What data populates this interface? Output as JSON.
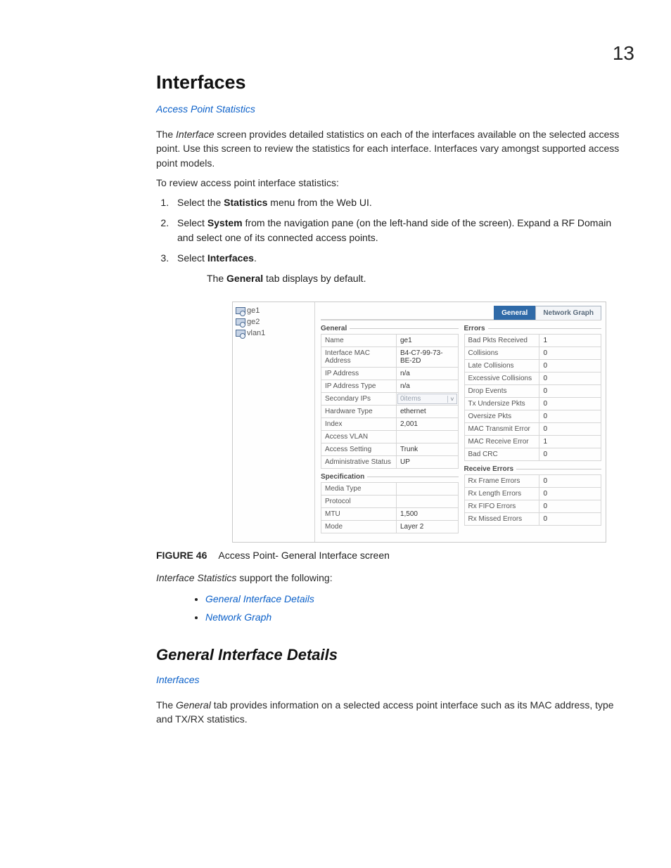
{
  "pageNumber": "13",
  "h1": "Interfaces",
  "link_aps": "Access Point Statistics",
  "p1_a": "The ",
  "p1_b": "Interface",
  "p1_c": " screen provides detailed statistics on each of the interfaces available on the selected access point. Use this screen to review the statistics for each interface. Interfaces vary amongst supported access point models.",
  "p2": "To review access point interface statistics:",
  "ol": {
    "i1a": "Select the ",
    "i1b": "Statistics",
    "i1c": " menu from the Web UI.",
    "i2a": "Select ",
    "i2b": "System",
    "i2c": " from the navigation pane (on the left-hand side of the screen). Expand a RF Domain and select one of its connected access points.",
    "i3a": "Select ",
    "i3b": "Interfaces",
    "i3c": "."
  },
  "sub_a": "The ",
  "sub_b": "General",
  "sub_c": " tab displays by default.",
  "fig": {
    "nav": {
      "i0": "ge1",
      "i1": "ge2",
      "i2": "vlan1"
    },
    "tabs": {
      "general": "General",
      "netgraph": "Network Graph"
    },
    "sec_general": "General",
    "general": {
      "0": {
        "l": "Name",
        "v": "ge1"
      },
      "1": {
        "l": "Interface MAC Address",
        "v": "B4-C7-99-73-BE-2D"
      },
      "2": {
        "l": "IP Address",
        "v": "n/a"
      },
      "3": {
        "l": "IP Address Type",
        "v": "n/a"
      },
      "4": {
        "l": "Secondary IPs",
        "v": "0items"
      },
      "5": {
        "l": "Hardware Type",
        "v": "ethernet"
      },
      "6": {
        "l": "Index",
        "v": "2,001"
      },
      "7": {
        "l": "Access VLAN",
        "v": ""
      },
      "8": {
        "l": "Access Setting",
        "v": "Trunk"
      },
      "9": {
        "l": "Administrative Status",
        "v": "UP"
      }
    },
    "sec_spec": "Specification",
    "spec": {
      "0": {
        "l": "Media Type",
        "v": ""
      },
      "1": {
        "l": "Protocol",
        "v": ""
      },
      "2": {
        "l": "MTU",
        "v": "1,500"
      },
      "3": {
        "l": "Mode",
        "v": "Layer 2"
      }
    },
    "sec_errors": "Errors",
    "errors": {
      "0": {
        "l": "Bad Pkts Received",
        "v": "1"
      },
      "1": {
        "l": "Collisions",
        "v": "0"
      },
      "2": {
        "l": "Late Collisions",
        "v": "0"
      },
      "3": {
        "l": "Excessive Collisions",
        "v": "0"
      },
      "4": {
        "l": "Drop Events",
        "v": "0"
      },
      "5": {
        "l": "Tx Undersize Pkts",
        "v": "0"
      },
      "6": {
        "l": "Oversize Pkts",
        "v": "0"
      },
      "7": {
        "l": "MAC Transmit Error",
        "v": "0"
      },
      "8": {
        "l": "MAC Receive Error",
        "v": "1"
      },
      "9": {
        "l": "Bad CRC",
        "v": "0"
      }
    },
    "sec_rxerr": "Receive Errors",
    "rxerr": {
      "0": {
        "l": "Rx Frame Errors",
        "v": "0"
      },
      "1": {
        "l": "Rx Length Errors",
        "v": "0"
      },
      "2": {
        "l": "Rx FIFO Errors",
        "v": "0"
      },
      "3": {
        "l": "Rx Missed Errors",
        "v": "0"
      }
    }
  },
  "fig_num": "FIGURE 46",
  "fig_cap": "Access Point- General Interface screen",
  "p3_a": "Interface Statistics",
  "p3_b": " support the following:",
  "bul1": "General Interface Details",
  "bul2": "Network Graph",
  "h2": "General Interface Details",
  "link_if": "Interfaces",
  "p4_a": "The ",
  "p4_b": "General",
  "p4_c": " tab provides information on a selected access point interface such as its MAC address, type and TX/RX statistics."
}
